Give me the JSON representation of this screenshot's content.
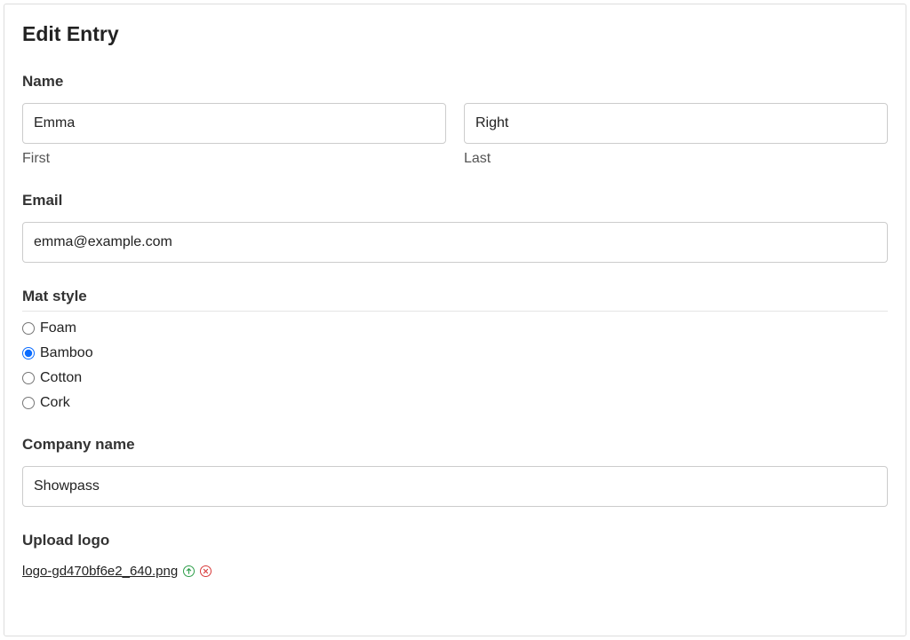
{
  "title": "Edit Entry",
  "name": {
    "label": "Name",
    "first": {
      "value": "Emma",
      "sublabel": "First"
    },
    "last": {
      "value": "Right",
      "sublabel": "Last"
    }
  },
  "email": {
    "label": "Email",
    "value": "emma@example.com"
  },
  "mat_style": {
    "label": "Mat style",
    "options": [
      "Foam",
      "Bamboo",
      "Cotton",
      "Cork"
    ],
    "selected": "Bamboo"
  },
  "company": {
    "label": "Company name",
    "value": "Showpass"
  },
  "upload": {
    "label": "Upload logo",
    "filename": "logo-gd470bf6e2_640.png"
  }
}
